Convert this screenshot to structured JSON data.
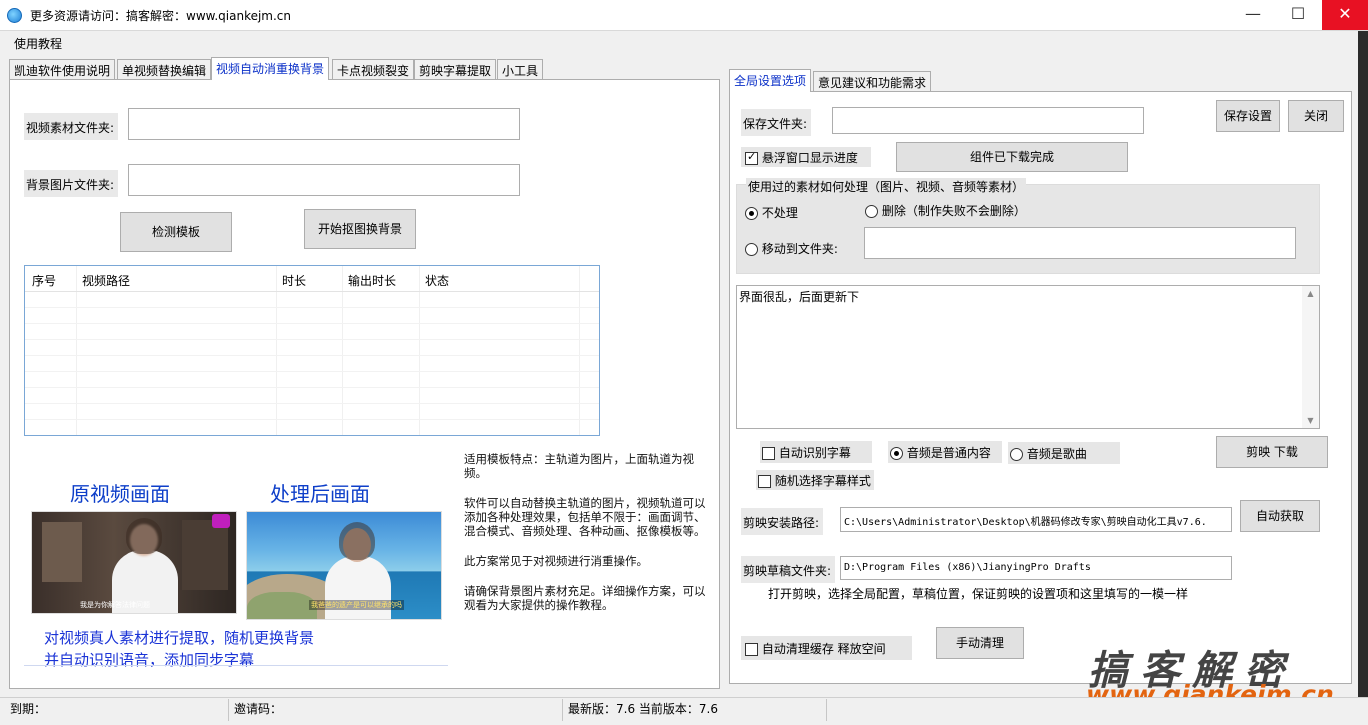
{
  "window": {
    "title": "更多资源请访问：搞客解密：www.qiankejm.cn",
    "minimize": "—",
    "maximize": "☐",
    "close": "✕"
  },
  "menu": {
    "help": "使用教程"
  },
  "left_tabs": [
    "凯迪软件使用说明",
    "单视频替换编辑",
    "视频自动消重换背景",
    "卡点视频裂变",
    "剪映字幕提取",
    "小工具"
  ],
  "left": {
    "video_folder_label": "视频素材文件夹:",
    "video_folder_value": "",
    "bg_folder_label": "背景图片文件夹:",
    "bg_folder_value": "",
    "detect_button": "检测模板",
    "start_button": "开始抠图换背景",
    "grid_columns": [
      "序号",
      "视频路径",
      "时长",
      "输出时长",
      "状态"
    ],
    "preview": {
      "original_title": "原视频画面",
      "processed_title": "处理后画面",
      "subtitle_left": "我是为你解答法律问题",
      "subtitle_right": "我爸爸的遗产是可以继承的吗",
      "caption_line1": "对视频真人素材进行提取，随机更换背景",
      "caption_line2": "并自动识别语音，添加同步字幕"
    },
    "description": [
      "适用模板特点：主轨道为图片，上面轨道为视频。",
      "软件可以自动替换主轨道的图片，视频轨道可以添加各种处理效果，包括单不限于：画面调节、混合模式、音频处理、各种动画、抠像模板等。",
      "此方案常见于对视频进行消重操作。",
      "请确保背景图片素材充足。详细操作方案，可以观看为大家提供的操作教程。"
    ]
  },
  "right_tabs": [
    "全局设置选项",
    "意见建议和功能需求"
  ],
  "right": {
    "save_folder_label": "保存文件夹:",
    "save_folder_value": "",
    "save_settings_button": "保存设置",
    "close_button": "关闭",
    "floating_progress_label": "悬浮窗口显示进度",
    "components_button": "组件已下载完成",
    "group_title": "使用过的素材如何处理（图片、视频、音频等素材）",
    "opt_none": "不处理",
    "opt_delete": "删除（制作失败不会删除）",
    "opt_move": "移动到文件夹:",
    "move_folder_value": "",
    "notes_text": "界面很乱，后面更新下",
    "auto_subtitle": "自动识别字幕",
    "audio_normal": "音频是普通内容",
    "audio_song": "音频是歌曲",
    "jianying_download_button": "剪映 下载",
    "random_subtitle_style": "随机选择字幕样式",
    "install_path_label": "剪映安装路径:",
    "install_path_value": "C:\\Users\\Administrator\\Desktop\\机器码修改专家\\剪映自动化工具v7.6.",
    "auto_get_button": "自动获取",
    "draft_folder_label": "剪映草稿文件夹:",
    "draft_folder_value": "D:\\Program Files (x86)\\JianyingPro Drafts",
    "hint": "打开剪映，选择全局配置，草稿位置，保证剪映的设置项和这里填写的一模一样",
    "auto_clean": "自动清理缓存 释放空间",
    "manual_clean_button": "手动清理"
  },
  "status": {
    "expiry": "到期：",
    "invite": "邀请码：",
    "version": "最新版：7.6 当前版本：7.6"
  },
  "watermark": {
    "cn": "搞客解密",
    "url": "www.qiankejm.cn"
  },
  "colors": {
    "accent": "#0b30c8",
    "close_red": "#e81123",
    "watermark_orange": "#e36410"
  }
}
